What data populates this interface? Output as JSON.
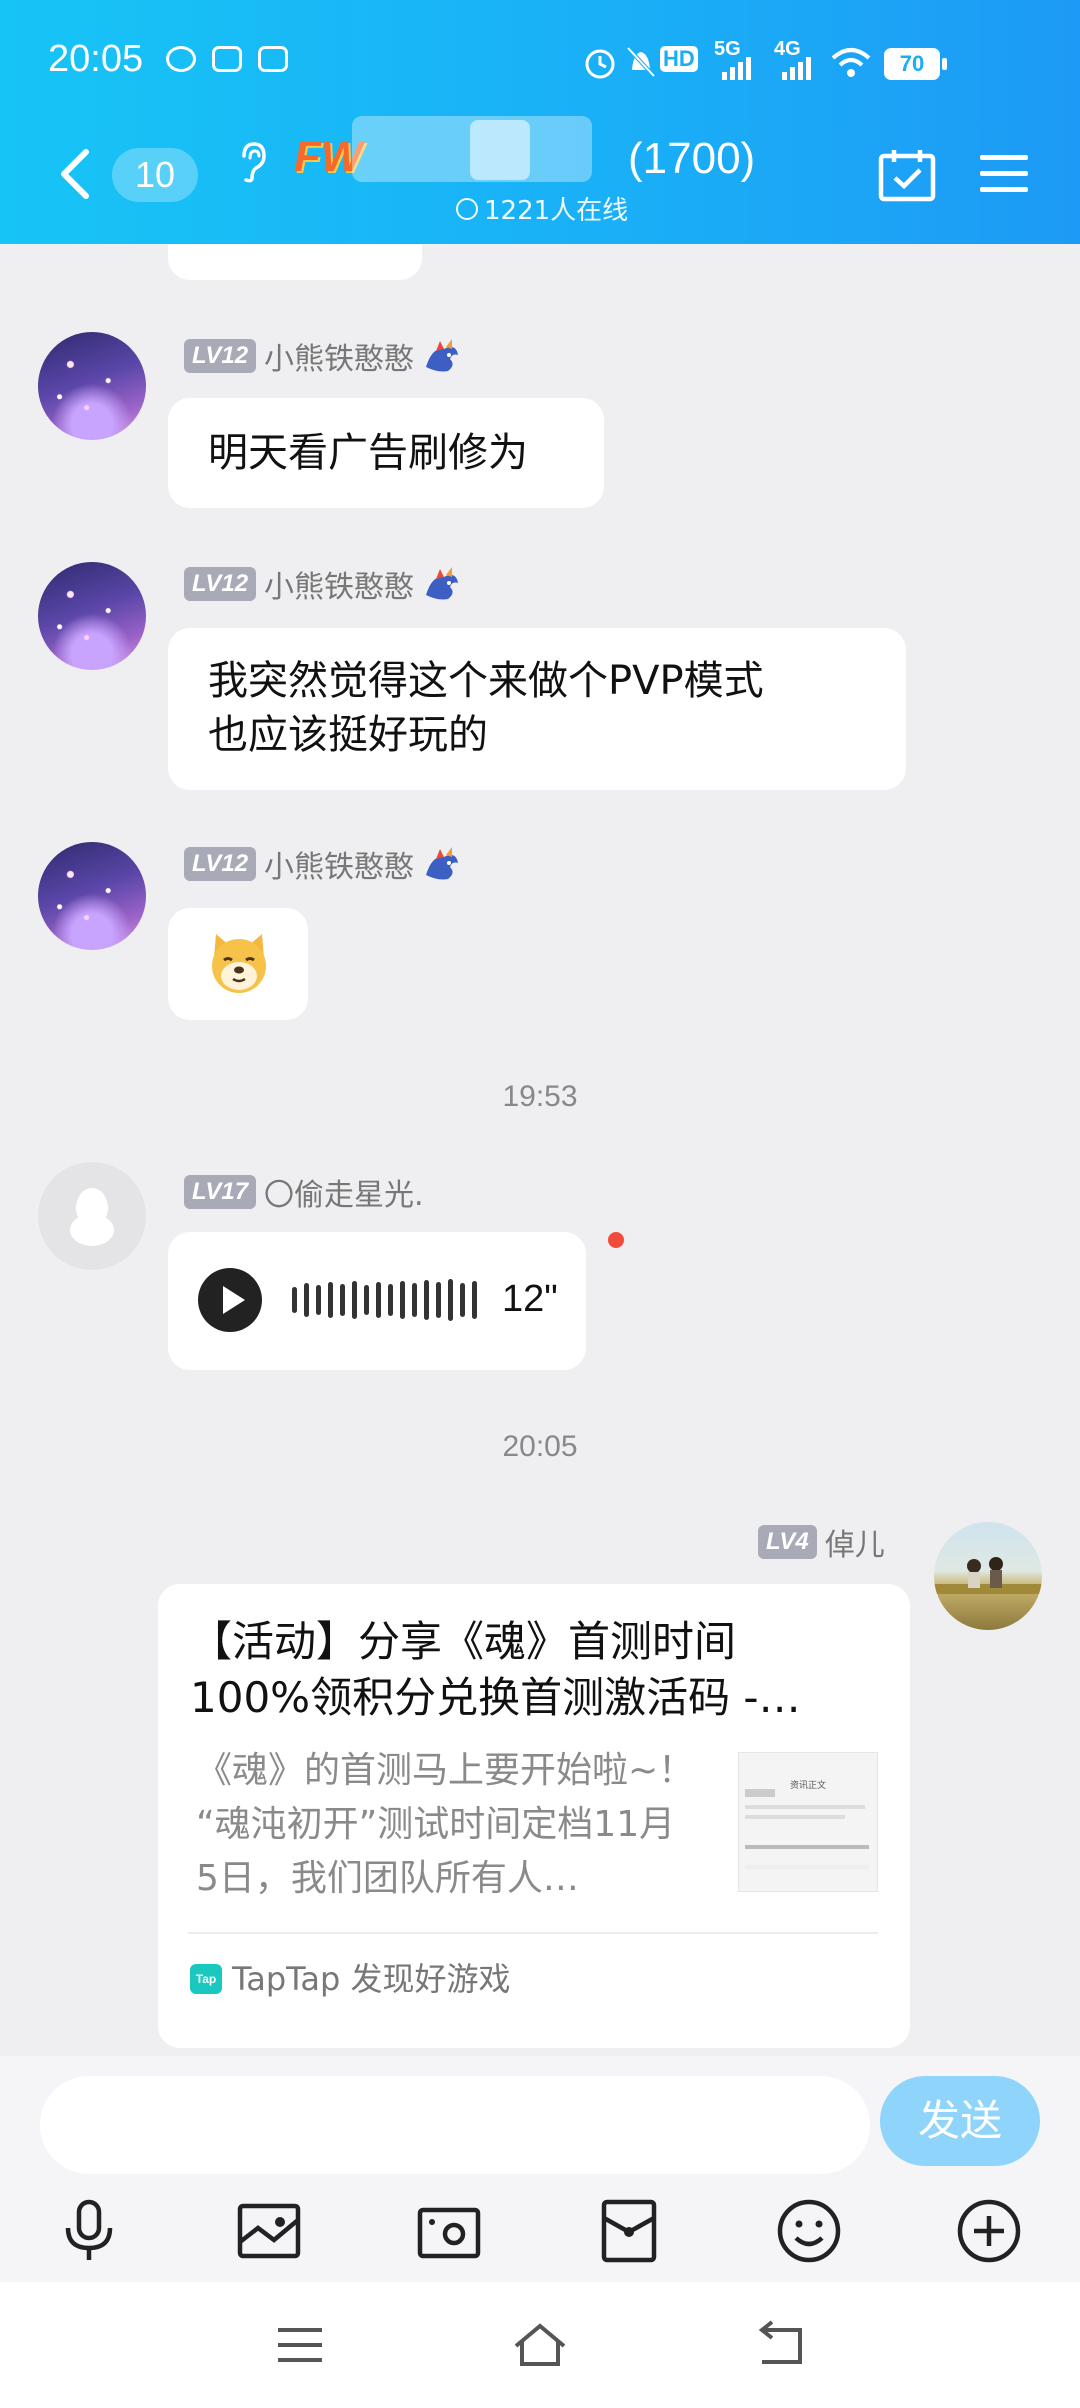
{
  "status_bar": {
    "time": "20:05",
    "network_labels": [
      "HD",
      "5G",
      "4G"
    ],
    "battery": "70"
  },
  "header": {
    "unread_count": "10",
    "group_name_visible": "FW",
    "member_count": "(1700)",
    "online_text": "1221人在线"
  },
  "messages": [
    {
      "sender_level": "LV12",
      "sender_name": "小熊铁憨憨",
      "text": "明天看广告刷修为"
    },
    {
      "sender_level": "LV12",
      "sender_name": "小熊铁憨憨",
      "text_line1": "我突然觉得这个来做个PVP模式",
      "text_line2": "也应该挺好玩的"
    },
    {
      "sender_level": "LV12",
      "sender_name": "小熊铁憨憨",
      "sticker": "doge-emoji"
    }
  ],
  "timestamps": [
    "19:53",
    "20:05"
  ],
  "voice_message": {
    "sender_level": "LV17",
    "sender_name": "〇偷走星光.",
    "duration": "12\""
  },
  "share_card": {
    "sender_level": "LV4",
    "sender_name": "倬儿",
    "title_line1": "【活动】分享《魂》首测时间",
    "title_line2": "100%领积分兑换首测激活码 -…",
    "desc_line1": "《魂》的首测马上要开始啦~！",
    "desc_line2": "“魂沌初开”测试时间定档11月",
    "desc_line3": "5日，我们团队所有人…",
    "thumb_header": "资讯正文",
    "source": "TapTap 发现好游戏",
    "source_logo": "Tap"
  },
  "input": {
    "placeholder": "",
    "send_label": "发送"
  },
  "toolbar_icons": [
    "microphone-icon",
    "image-icon",
    "camera-icon",
    "red-packet-icon",
    "emoji-icon",
    "plus-icon"
  ],
  "nav_icons": [
    "menu-icon",
    "home-icon",
    "back-icon"
  ],
  "colors": {
    "header_gradient_start": "#17c4f6",
    "header_gradient_end": "#1d9af5",
    "send_button": "#8fd4fb",
    "level_badge": "#a9aab8",
    "unread_dot": "#f24a3b"
  }
}
